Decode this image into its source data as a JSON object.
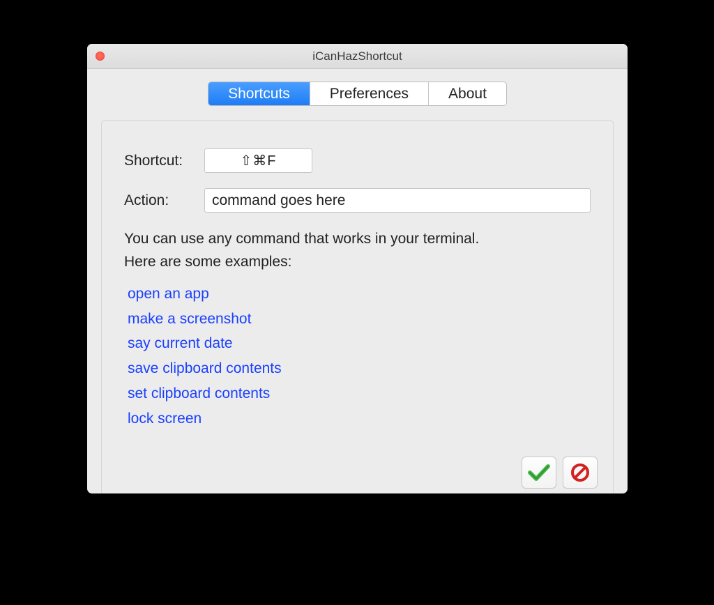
{
  "window": {
    "title": "iCanHazShortcut"
  },
  "tabs": [
    {
      "label": "Shortcuts",
      "active": true
    },
    {
      "label": "Preferences",
      "active": false
    },
    {
      "label": "About",
      "active": false
    }
  ],
  "form": {
    "shortcut_label": "Shortcut:",
    "shortcut_value": "⇧⌘F",
    "action_label": "Action:",
    "action_value": "command goes here"
  },
  "help": {
    "line1": "You can use any command that works in your terminal.",
    "line2": "Here are some examples:"
  },
  "examples": [
    "open an app",
    "make a screenshot",
    "say current date",
    "save clipboard contents",
    "set clipboard contents",
    "lock screen"
  ],
  "buttons": {
    "confirm": "confirm",
    "cancel": "cancel"
  }
}
